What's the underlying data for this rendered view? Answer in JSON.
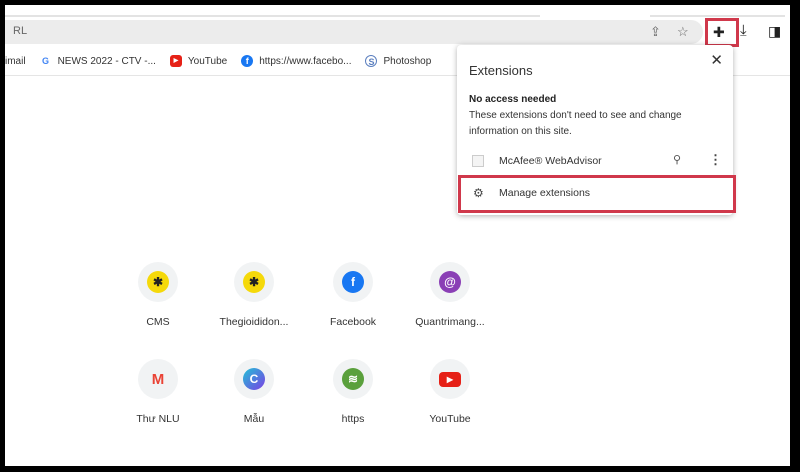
{
  "omnibox": {
    "url_text": "RL"
  },
  "bookmarks": [
    {
      "label": "imail",
      "icon": "gmail-icon"
    },
    {
      "label": "NEWS 2022 - CTV -...",
      "icon": "google-icon",
      "color": "#4285f4"
    },
    {
      "label": "YouTube",
      "icon": "youtube-icon",
      "color": "#e62117"
    },
    {
      "label": "https://www.facebo...",
      "icon": "facebook-icon",
      "color": "#1877f2"
    },
    {
      "label": "Photoshop",
      "icon": "photoshop-icon",
      "color": "#5b7fbf"
    }
  ],
  "extensions_popup": {
    "title": "Extensions",
    "close": "✕",
    "section_heading": "No access needed",
    "section_desc": "These extensions don't need to see and change information on this site.",
    "items": [
      {
        "name": "McAfee® WebAdvisor"
      }
    ],
    "manage_label": "Manage extensions"
  },
  "shortcuts": [
    {
      "label": "CMS",
      "color": "#f5d90a",
      "glyph": "✱"
    },
    {
      "label": "Thegioididon...",
      "color": "#f5d90a",
      "glyph": "✱"
    },
    {
      "label": "Facebook",
      "color": "#1877f2",
      "glyph": "f"
    },
    {
      "label": "Quantrimang...",
      "color": "#8a3fb5",
      "glyph": "@"
    },
    {
      "label": "Thư NLU",
      "color": "#ea4335",
      "glyph": "M"
    },
    {
      "label": "Mẫu",
      "color": "#5b5be8",
      "glyph": "C"
    },
    {
      "label": "https",
      "color": "#5aa03c",
      "glyph": "≋"
    },
    {
      "label": "YouTube",
      "color": "#e62117",
      "glyph": "▶"
    }
  ]
}
